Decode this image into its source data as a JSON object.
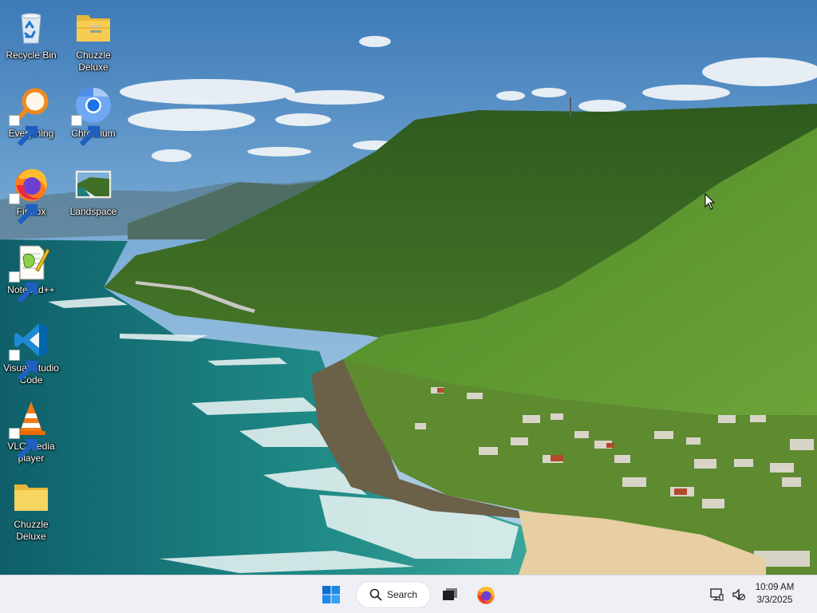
{
  "desktop": {
    "icons": [
      {
        "label": "Recycle Bin",
        "icon": "recycle-bin-icon",
        "shortcut": false
      },
      {
        "label": "Chuzzle Deluxe",
        "icon": "zip-folder-icon",
        "shortcut": false
      },
      {
        "label": "Everything",
        "icon": "everything-search-icon",
        "shortcut": true
      },
      {
        "label": "Chromium",
        "icon": "chromium-icon",
        "shortcut": true
      },
      {
        "label": "Firefox",
        "icon": "firefox-icon",
        "shortcut": true
      },
      {
        "label": "Landspace",
        "icon": "image-file-icon",
        "shortcut": false
      },
      {
        "label": "Notepad++",
        "icon": "notepad-plus-plus-icon",
        "shortcut": true
      },
      {
        "label": "Visual Studio Code",
        "icon": "vscode-icon",
        "shortcut": true
      },
      {
        "label": "VLC media player",
        "icon": "vlc-icon",
        "shortcut": true
      },
      {
        "label": "Chuzzle Deluxe",
        "icon": "folder-icon",
        "shortcut": false
      }
    ]
  },
  "taskbar": {
    "start_icon": "windows-start-icon",
    "search_label": "Search",
    "taskview_icon": "task-view-icon",
    "pinned": [
      {
        "name": "Firefox",
        "icon": "firefox-icon"
      }
    ],
    "tray_icons": [
      "network-icon",
      "volume-muted-icon"
    ],
    "clock": {
      "time": "10:09 AM",
      "date": "3/3/2025"
    }
  },
  "colors": {
    "taskbar_bg": "#eef0f5",
    "accent_blue": "#0078d4",
    "label_text": "#ffffff"
  }
}
